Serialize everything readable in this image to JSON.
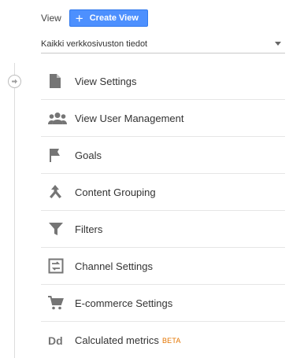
{
  "header": {
    "view_label": "View",
    "create_button_label": "Create View"
  },
  "view_selector": {
    "selected": "Kaikki verkkosivuston tiedot"
  },
  "menu": {
    "items": [
      {
        "label": "View Settings",
        "icon": "document-icon"
      },
      {
        "label": "View User Management",
        "icon": "users-icon"
      },
      {
        "label": "Goals",
        "icon": "flag-icon"
      },
      {
        "label": "Content Grouping",
        "icon": "merge-icon"
      },
      {
        "label": "Filters",
        "icon": "filter-icon"
      },
      {
        "label": "Channel Settings",
        "icon": "channel-settings-icon"
      },
      {
        "label": "E-commerce Settings",
        "icon": "cart-icon"
      },
      {
        "label": "Calculated metrics",
        "icon": "calculated-metrics-icon",
        "badge": "BETA"
      }
    ]
  },
  "colors": {
    "primary_button": "#4d90fe",
    "icon": "#757575",
    "beta_badge": "#e37400"
  }
}
